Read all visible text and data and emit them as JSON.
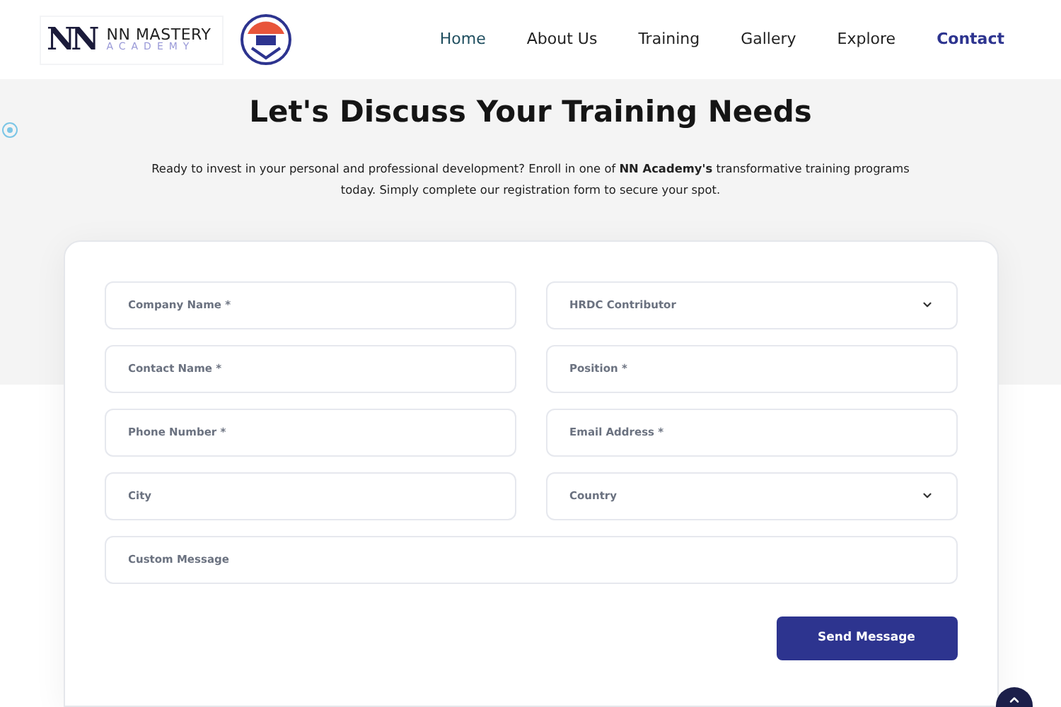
{
  "logo": {
    "monogram": "NN",
    "name": "NN MASTERY",
    "subtitle": "ACADEMY"
  },
  "nav": [
    {
      "label": "Home",
      "selected": false,
      "color": "#1f4e5f"
    },
    {
      "label": "About Us",
      "selected": false,
      "color": "#222222"
    },
    {
      "label": "Training",
      "selected": false,
      "color": "#222222"
    },
    {
      "label": "Gallery",
      "selected": false,
      "color": "#222222"
    },
    {
      "label": "Explore",
      "selected": false,
      "color": "#222222"
    },
    {
      "label": "Contact",
      "selected": true,
      "color": "#2d348f"
    }
  ],
  "heading": "Let's Discuss Your Training Needs",
  "intro": "Ready to invest in your personal and professional development? Enroll in one of **NN Academy's** transformative training programs today. Simply complete our registration form to secure your spot.",
  "fields": [
    {
      "kind": "input",
      "placeholder": "Company Name *"
    },
    {
      "kind": "select",
      "value": "HRDC Contributor"
    },
    {
      "kind": "input",
      "placeholder": "Contact Name *"
    },
    {
      "kind": "input",
      "placeholder": "Position *"
    },
    {
      "kind": "input",
      "placeholder": "Phone Number *"
    },
    {
      "kind": "input",
      "placeholder": "Email Address *"
    },
    {
      "kind": "input",
      "placeholder": "City"
    },
    {
      "kind": "select",
      "value": "Country"
    },
    {
      "kind": "textarea",
      "placeholder": "Custom Message"
    }
  ],
  "submit": "Send Message"
}
